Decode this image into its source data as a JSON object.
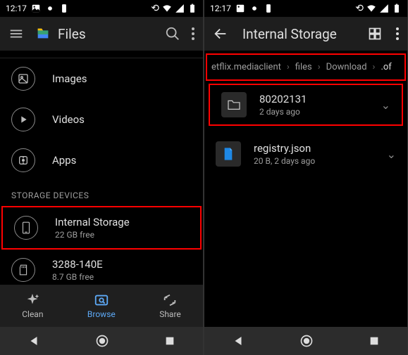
{
  "status": {
    "time": "12:17"
  },
  "left": {
    "app_title": "Files",
    "items": [
      {
        "label": "Images"
      },
      {
        "label": "Videos"
      },
      {
        "label": "Apps"
      }
    ],
    "section_header": "STORAGE DEVICES",
    "storage": [
      {
        "label": "Internal Storage",
        "sub": "22 GB free"
      },
      {
        "label": "3288-140E",
        "sub": "8.7 GB free"
      }
    ],
    "nav": {
      "clean": "Clean",
      "browse": "Browse",
      "share": "Share"
    }
  },
  "right": {
    "app_title": "Internal Storage",
    "breadcrumb": [
      "etflix.mediaclient",
      "files",
      "Download",
      ".of"
    ],
    "files": [
      {
        "name": "80202131",
        "sub": "2 days ago",
        "type": "folder"
      },
      {
        "name": "registry.json",
        "sub": "20 B, 2 days ago",
        "type": "file"
      }
    ]
  }
}
